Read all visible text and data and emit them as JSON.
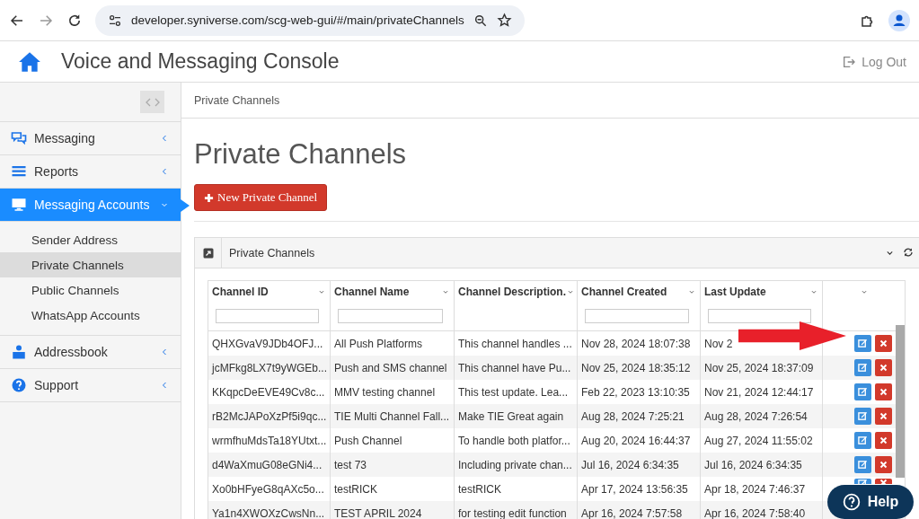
{
  "browser": {
    "url": "developer.syniverse.com/scg-web-gui/#/main/privateChannels"
  },
  "header": {
    "title": "Voice and Messaging Console",
    "logout": "Log Out"
  },
  "sidebar": {
    "items": [
      {
        "label": "Messaging",
        "selected": false,
        "expanded": false
      },
      {
        "label": "Reports",
        "selected": false,
        "expanded": false
      },
      {
        "label": "Messaging Accounts",
        "selected": true,
        "expanded": true,
        "children": [
          {
            "label": "Sender Address",
            "selected": false
          },
          {
            "label": "Private Channels",
            "selected": true
          },
          {
            "label": "Public Channels",
            "selected": false
          },
          {
            "label": "WhatsApp Accounts",
            "selected": false
          }
        ]
      },
      {
        "label": "Addressbook",
        "selected": false,
        "expanded": false
      },
      {
        "label": "Support",
        "selected": false,
        "expanded": false
      }
    ]
  },
  "breadcrumb": "Private Channels",
  "page_title": "Private Channels",
  "new_button": "New Private Channel",
  "panel": {
    "title": "Private Channels",
    "table": {
      "columns": [
        {
          "label": "Channel ID",
          "filter": true
        },
        {
          "label": "Channel Name",
          "filter": true
        },
        {
          "label": "Channel Description.",
          "filter": false
        },
        {
          "label": "Channel Created",
          "filter": true
        },
        {
          "label": "Last Update",
          "filter": true
        },
        {
          "filter": false
        }
      ],
      "rows": [
        {
          "cells": [
            "QHXGvaV9JDb4OFJ...",
            "All Push Platforms",
            "This channel handles ...",
            "Nov 28, 2024 18:07:38",
            "Nov 2"
          ],
          "actions": true
        },
        {
          "cells": [
            "jcMFkg8LX7t9yWGEb...",
            "Push and SMS channel",
            "This channel have Pu...",
            "Nov 25, 2024 18:35:12",
            "Nov 25, 2024 18:37:09"
          ],
          "actions": true
        },
        {
          "cells": [
            "KKqpcDeEVE49Cv8c...",
            "MMV testing channel",
            "This test update. Lea...",
            "Feb 22, 2023 13:10:35",
            "Nov 21, 2024 12:44:17"
          ],
          "actions": true
        },
        {
          "cells": [
            "rB2McJAPoXzPf5i9qc...",
            "TIE Multi Channel Fall...",
            "Make TIE Great again",
            "Aug 28, 2024 7:25:21",
            "Aug 28, 2024 7:26:54"
          ],
          "actions": true
        },
        {
          "cells": [
            "wrmfhuMdsTa18YUtxt...",
            "Push Channel",
            "To handle both platfor...",
            "Aug 20, 2024 16:44:37",
            "Aug 27, 2024 11:55:02"
          ],
          "actions": true
        },
        {
          "cells": [
            "d4WaXmuG08eGNi4...",
            "test 73",
            "Including private chan...",
            "Jul 16, 2024 6:34:35",
            "Jul 16, 2024 6:34:35"
          ],
          "actions": true
        },
        {
          "cells": [
            "Xo0bHFyeG8qAXc5o...",
            "testRICK",
            "testRICK",
            "Apr 17, 2024 13:56:35",
            "Apr 18, 2024 7:46:37"
          ],
          "actions": true
        },
        {
          "cells": [
            "Ya1n4XWOXzCwsNn...",
            "TEST APRIL 2024",
            "for testing edit function",
            "Apr 16, 2024 7:57:58",
            "Apr 16, 2024 7:58:40"
          ]
        }
      ]
    }
  },
  "help": "Help"
}
